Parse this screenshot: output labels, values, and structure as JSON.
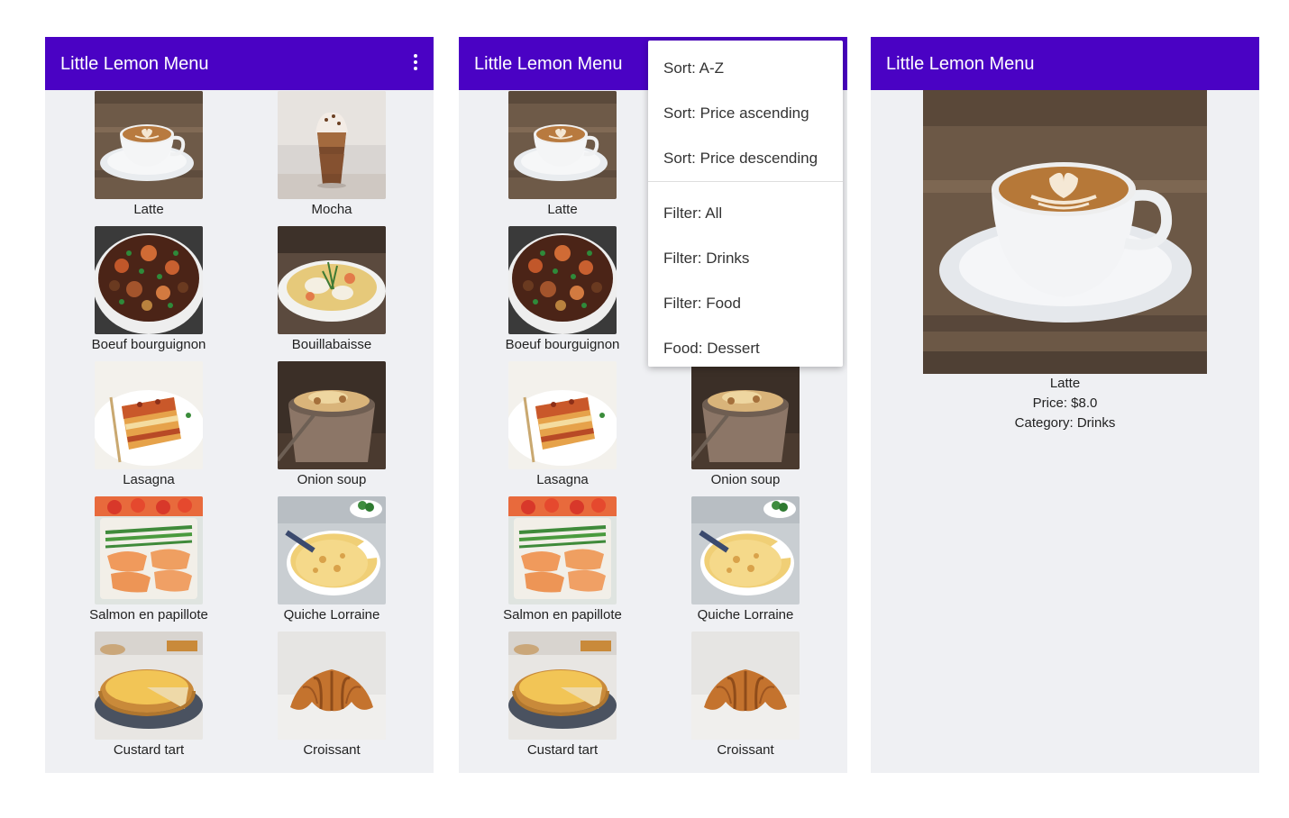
{
  "app": {
    "title": "Little Lemon Menu"
  },
  "menu_items": [
    {
      "name": "Latte",
      "icon": "latte"
    },
    {
      "name": "Mocha",
      "icon": "mocha"
    },
    {
      "name": "Boeuf bourguignon",
      "icon": "stew"
    },
    {
      "name": "Bouillabaisse",
      "icon": "soup-bowl"
    },
    {
      "name": "Lasagna",
      "icon": "lasagna"
    },
    {
      "name": "Onion soup",
      "icon": "onion-soup"
    },
    {
      "name": "Salmon en papillote",
      "icon": "salmon"
    },
    {
      "name": "Quiche Lorraine",
      "icon": "quiche"
    },
    {
      "name": "Custard tart",
      "icon": "tart"
    },
    {
      "name": "Croissant",
      "icon": "croissant"
    }
  ],
  "options_menu": {
    "sort_az": "Sort: A-Z",
    "sort_price_asc": "Sort: Price ascending",
    "sort_price_desc": "Sort: Price descending",
    "filter_all": "Filter: All",
    "filter_drinks": "Filter: Drinks",
    "filter_food": "Filter: Food",
    "food_dessert": "Food: Dessert"
  },
  "detail": {
    "name": "Latte",
    "price": "Price: $8.0",
    "category": "Category: Drinks"
  },
  "colors": {
    "appbar": "#4a02c4",
    "background": "#eff0f3"
  }
}
